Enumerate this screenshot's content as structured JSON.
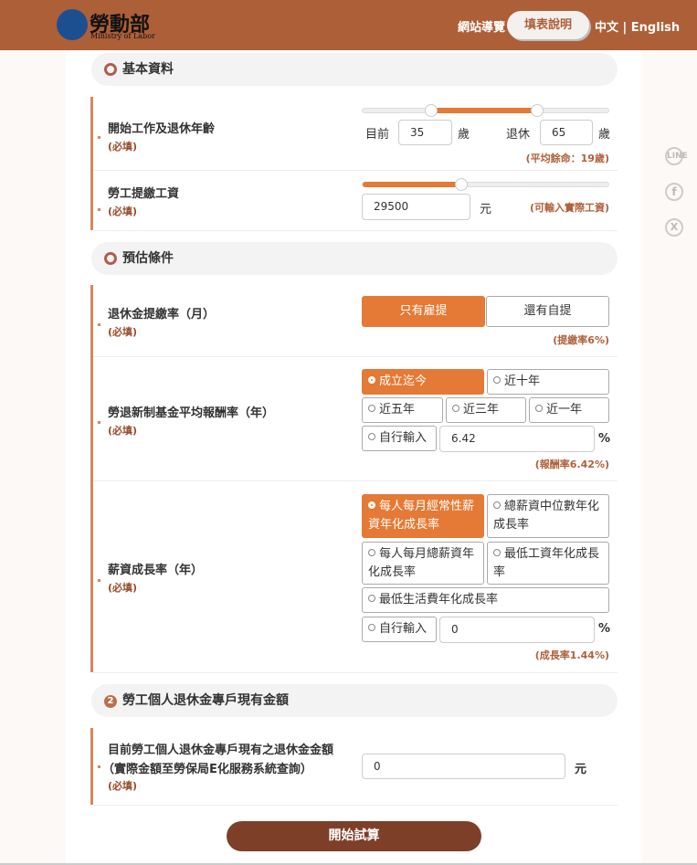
{
  "header": {
    "logo_title": "勞動部",
    "logo_subtitle": "Ministry of Labor",
    "sitemap": "網站導覽",
    "help_button": "填表說明",
    "lang": "中文 | English",
    "bg_color": "#ad5f38"
  },
  "social": [
    "line-icon",
    "facebook-icon",
    "x-icon"
  ],
  "social_labels": {
    "line": "LINE",
    "facebook": "f",
    "x": "X"
  },
  "section1": {
    "title": "基本資料",
    "age": {
      "label": "開始工作及退休年齡",
      "required": "(必填)",
      "current_label": "目前",
      "current_value": "35",
      "retire_label": "退休",
      "retire_value": "65",
      "unit": "歲",
      "note": "(平均餘命：19歲)"
    },
    "salary": {
      "label": "勞工提繳工資",
      "required": "(必填)",
      "value": "29500",
      "unit": "元",
      "note": "(可輸入實際工資)",
      "slider_fill_percent": 40
    }
  },
  "section2": {
    "title": "預估條件",
    "rate": {
      "label": "退休金提繳率（月）",
      "required": "(必填)",
      "options": [
        "只有雇提",
        "還有自提"
      ],
      "selected": 0,
      "note": "(提繳率6%)"
    },
    "fund": {
      "label": "勞退新制基金平均報酬率（年）",
      "required": "(必填)",
      "options": [
        "成立迄今",
        "近十年",
        "近五年",
        "近三年",
        "近一年",
        "自行輸入"
      ],
      "selected": 0,
      "custom_value": "6.42",
      "unit": "%",
      "note": "(報酬率6.42%)"
    },
    "growth": {
      "label": "薪資成長率（年）",
      "required": "(必填)",
      "options": [
        "每人每月經常性薪資年化成長率",
        "總薪資中位數年化成長率",
        "每人每月總薪資年化成長率",
        "最低工資年化成長率",
        "最低生活費年化成長率",
        "自行輸入"
      ],
      "selected": 0,
      "custom_value": "0",
      "unit": "%",
      "note": "(成長率1.44%)"
    }
  },
  "section3": {
    "number": "2",
    "title": "勞工個人退休金專戶現有金額",
    "balance": {
      "label": "目前勞工個人退休金專戶現有之退休金金額",
      "label2": "（實際金額至勞保局E化服務系統查詢）",
      "required": "(必填)",
      "value": "0",
      "unit": "元"
    }
  },
  "submit": "開始試算"
}
